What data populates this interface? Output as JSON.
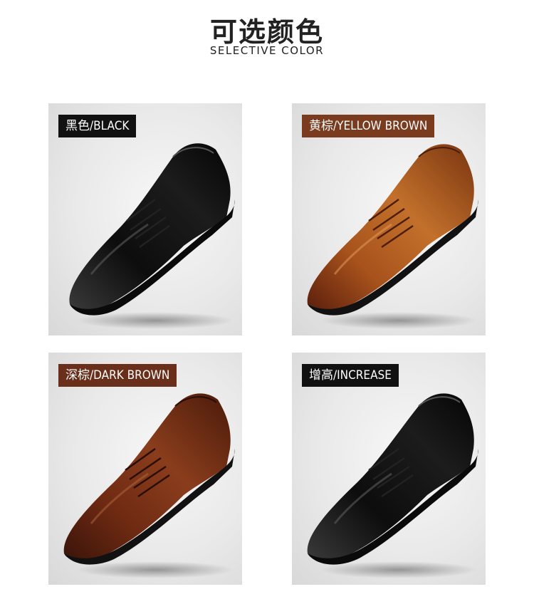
{
  "header": {
    "title_cn": "可选颜色",
    "title_en": "SELECTIVE COLOR"
  },
  "variants": [
    {
      "label": "黑色/BLACK",
      "label_bg": "#111111",
      "shoe_color": "black"
    },
    {
      "label": "黄棕/YELLOW BROWN",
      "label_bg": "#7a3b1e",
      "shoe_color": "yellow brown"
    },
    {
      "label": "深棕/DARK BROWN",
      "label_bg": "#6a2f1a",
      "shoe_color": "dark brown"
    },
    {
      "label": "增高/INCREASE",
      "label_bg": "#111111",
      "shoe_color": "black"
    }
  ]
}
